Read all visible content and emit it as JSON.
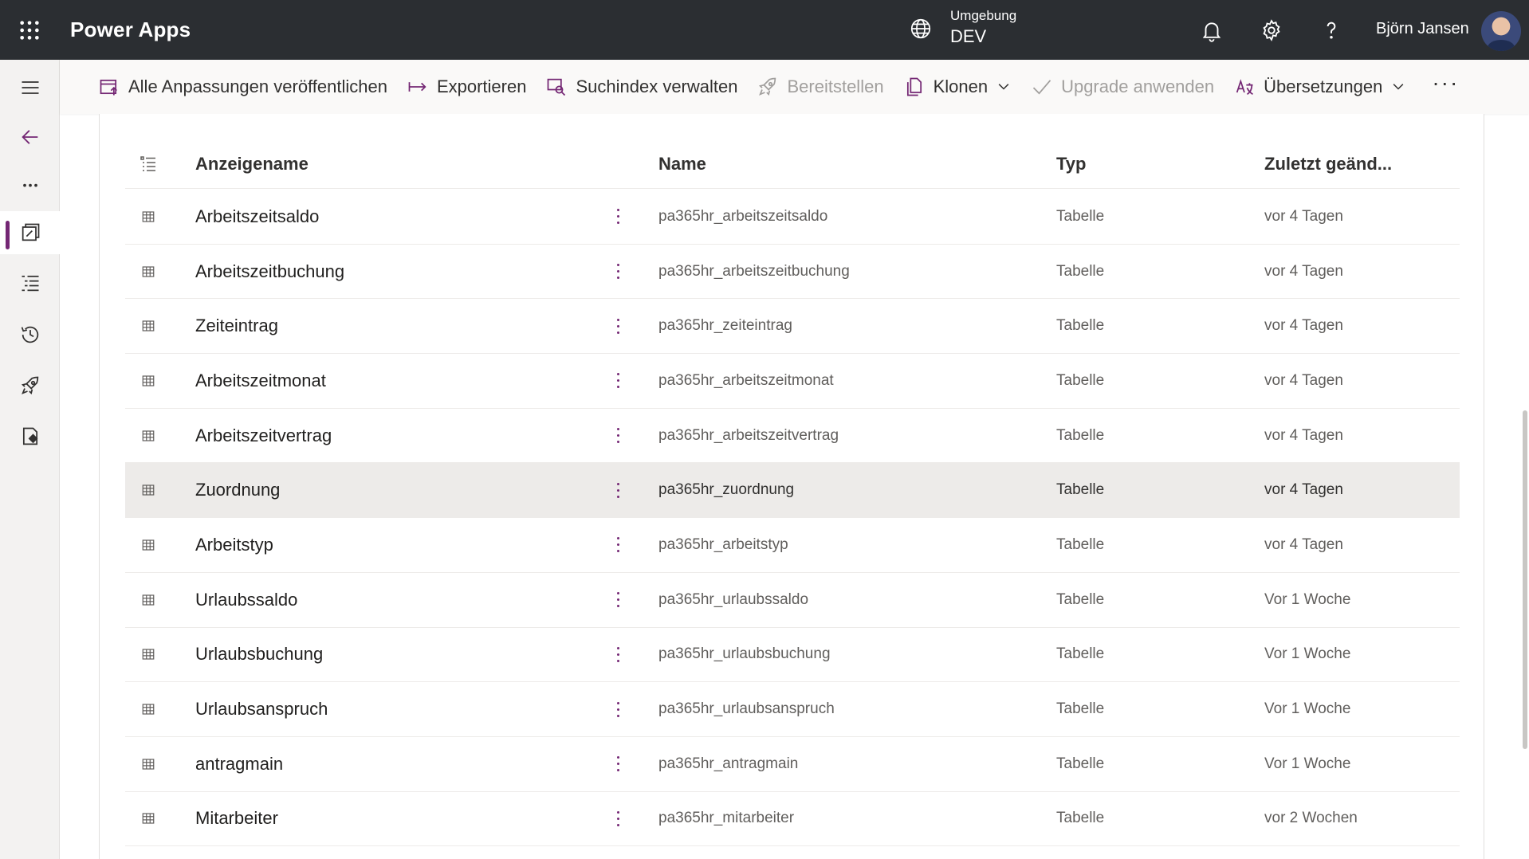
{
  "topbar": {
    "app_title": "Power Apps",
    "environment_label": "Umgebung",
    "environment_value": "DEV",
    "user_name": "Björn Jansen"
  },
  "commandbar": {
    "publish": "Alle Anpassungen veröffentlichen",
    "export": "Exportieren",
    "search_index": "Suchindex verwalten",
    "deploy": "Bereitstellen",
    "clone": "Klonen",
    "upgrade": "Upgrade anwenden",
    "translations": "Übersetzungen",
    "more": "···"
  },
  "table": {
    "headers": {
      "display_name": "Anzeigename",
      "name": "Name",
      "type": "Typ",
      "modified": "Zuletzt geänd..."
    },
    "rows": [
      {
        "display": "Arbeitszeitsaldo",
        "name": "pa365hr_arbeitszeitsaldo",
        "type": "Tabelle",
        "modified": "vor 4 Tagen"
      },
      {
        "display": "Arbeitszeitbuchung",
        "name": "pa365hr_arbeitszeitbuchung",
        "type": "Tabelle",
        "modified": "vor 4 Tagen"
      },
      {
        "display": "Zeiteintrag",
        "name": "pa365hr_zeiteintrag",
        "type": "Tabelle",
        "modified": "vor 4 Tagen"
      },
      {
        "display": "Arbeitszeitmonat",
        "name": "pa365hr_arbeitszeitmonat",
        "type": "Tabelle",
        "modified": "vor 4 Tagen"
      },
      {
        "display": "Arbeitszeitvertrag",
        "name": "pa365hr_arbeitszeitvertrag",
        "type": "Tabelle",
        "modified": "vor 4 Tagen"
      },
      {
        "display": "Zuordnung",
        "name": "pa365hr_zuordnung",
        "type": "Tabelle",
        "modified": "vor 4 Tagen"
      },
      {
        "display": "Arbeitstyp",
        "name": "pa365hr_arbeitstyp",
        "type": "Tabelle",
        "modified": "vor 4 Tagen"
      },
      {
        "display": "Urlaubssaldo",
        "name": "pa365hr_urlaubssaldo",
        "type": "Tabelle",
        "modified": "Vor 1 Woche"
      },
      {
        "display": "Urlaubsbuchung",
        "name": "pa365hr_urlaubsbuchung",
        "type": "Tabelle",
        "modified": "Vor 1 Woche"
      },
      {
        "display": "Urlaubsanspruch",
        "name": "pa365hr_urlaubsanspruch",
        "type": "Tabelle",
        "modified": "Vor 1 Woche"
      },
      {
        "display": "antragmain",
        "name": "pa365hr_antragmain",
        "type": "Tabelle",
        "modified": "Vor 1 Woche"
      },
      {
        "display": "Mitarbeiter",
        "name": "pa365hr_mitarbeiter",
        "type": "Tabelle",
        "modified": "vor 2 Wochen"
      }
    ]
  },
  "colors": {
    "topbar_bg": "#2b2e32",
    "accent": "#742774",
    "selected_row": "#edebe9"
  }
}
